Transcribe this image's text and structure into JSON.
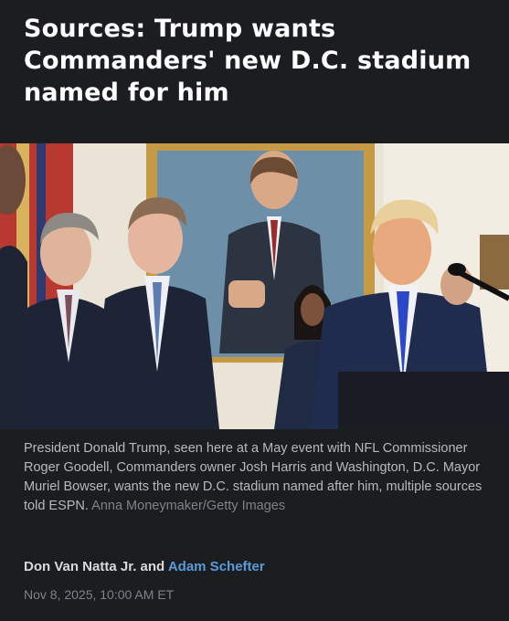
{
  "article": {
    "headline": "Sources: Trump wants Commanders' new D.C. stadium named for him",
    "photo_alt": "",
    "caption": "President Donald Trump, seen here at a May event with NFL Commissioner Roger Goodell, Commanders owner Josh Harris and Washington, D.C. Mayor Muriel Bowser, wants the new D.C. stadium named after him, multiple sources told ESPN.",
    "photo_credit": "Anna Moneymaker/Getty Images",
    "byline": {
      "author_1": "Don Van Natta Jr.",
      "conjunction": "and",
      "author_2": "Adam Schefter"
    },
    "timestamp": "Nov 8, 2025, 10:00 AM ET"
  },
  "colors": {
    "background": "#1b1d20",
    "headline": "#ffffff",
    "caption": "#b7b9bd",
    "credit": "#7f8287",
    "link": "#5b9bd8"
  }
}
